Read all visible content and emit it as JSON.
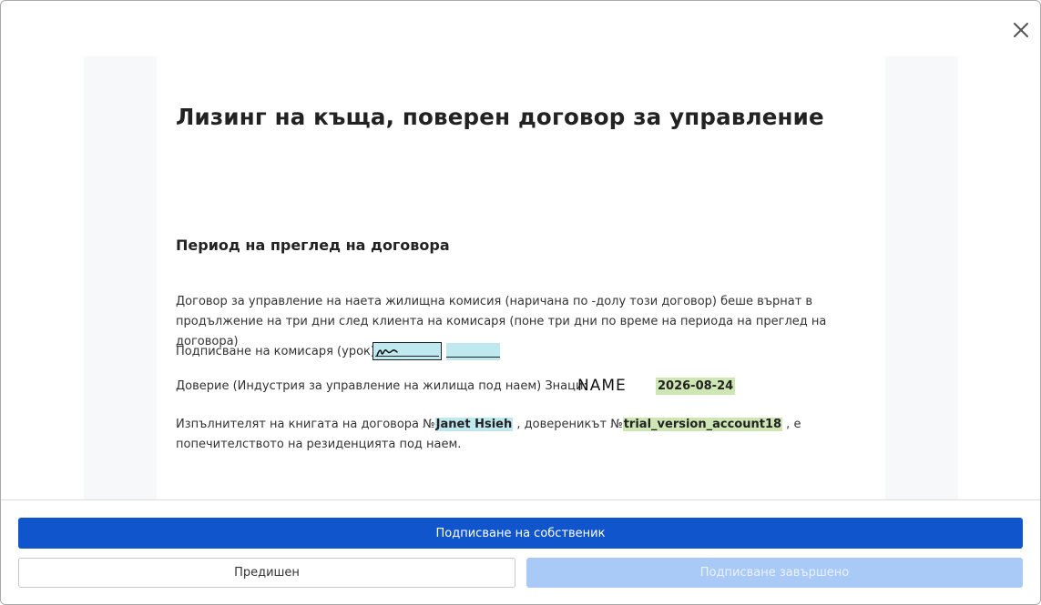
{
  "dialog": {
    "close_icon": "close-icon"
  },
  "document": {
    "title": "Лизинг на къща, поверен договор за управление",
    "section_title": "Период на преглед на договора",
    "paragraph1": "Договор за управление на наета жилищна комисия (наричана по -долу този договор) беше върнат в продължение на три дни след клиента на комисаря (поне три дни по време на периода на преглед на договора)",
    "sign_label": "Подписване на комисаря (урок):",
    "trust_label": "Доверие (Индустрия за управление на жилища под наем) Знаци:",
    "trust_signature": "NAME",
    "trust_date": "2026-08-24",
    "p3_prefix": "Изпълнителят на книгата на договора №",
    "p3_executor": "Janet Hsieh",
    "p3_middle": " , довереникът №",
    "p3_account": "trial_version_account18",
    "p3_suffix": " , е попечителството на резиденцията под наем."
  },
  "footer": {
    "primary_label": "Подписване на собственик",
    "prev_label": "Предишен",
    "done_label": "Подписване завършено"
  },
  "colors": {
    "primary": "#1155cc",
    "primary_disabled": "#a9c9f7",
    "field_blue": "#bfe8ef",
    "field_green": "#cde6b4"
  }
}
